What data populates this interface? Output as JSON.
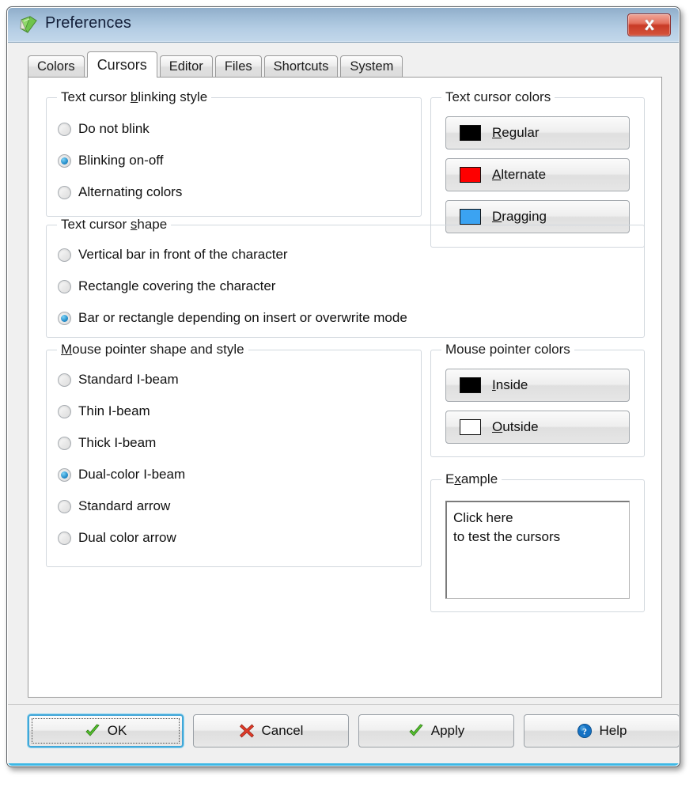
{
  "window": {
    "title": "Preferences",
    "icon": "notebook-icon",
    "close_label": "x"
  },
  "tabs": [
    {
      "label": "Colors",
      "active": false
    },
    {
      "label": "Cursors",
      "active": true
    },
    {
      "label": "Editor",
      "active": false
    },
    {
      "label": "Files",
      "active": false
    },
    {
      "label": "Shortcuts",
      "active": false
    },
    {
      "label": "System",
      "active": false
    }
  ],
  "groups": {
    "blinking_style": {
      "title_pre": "Text cursor ",
      "title_accel": "b",
      "title_post": "linking style",
      "options": [
        {
          "label": "Do not blink",
          "selected": false
        },
        {
          "label": "Blinking on-off",
          "selected": true
        },
        {
          "label": "Alternating colors",
          "selected": false
        }
      ]
    },
    "cursor_shape": {
      "title_pre": "Text cursor ",
      "title_accel": "s",
      "title_post": "hape",
      "options": [
        {
          "label": "Vertical bar in front of the character",
          "selected": false
        },
        {
          "label": "Rectangle covering the character",
          "selected": false
        },
        {
          "label": "Bar or rectangle depending on insert or overwrite mode",
          "selected": true
        }
      ]
    },
    "pointer_shape": {
      "title_pre": "",
      "title_accel": "M",
      "title_post": "ouse pointer shape and style",
      "options": [
        {
          "label": "Standard I-beam",
          "selected": false
        },
        {
          "label": "Thin I-beam",
          "selected": false
        },
        {
          "label": "Thick I-beam",
          "selected": false
        },
        {
          "label": "Dual-color I-beam",
          "selected": true
        },
        {
          "label": "Standard arrow",
          "selected": false
        },
        {
          "label": "Dual color arrow",
          "selected": false
        }
      ]
    },
    "cursor_colors": {
      "title": "Text cursor colors",
      "buttons": [
        {
          "accel": "R",
          "rest": "egular",
          "color": "#000000"
        },
        {
          "accel": "A",
          "rest": "lternate",
          "color": "#fe0000"
        },
        {
          "accel": "D",
          "rest": "ragging",
          "color": "#3ba3f2"
        }
      ]
    },
    "pointer_colors": {
      "title": "Mouse pointer colors",
      "buttons": [
        {
          "accel": "I",
          "rest": "nside",
          "color": "#000000"
        },
        {
          "accel": "O",
          "rest": "utside",
          "color": "#ffffff"
        }
      ]
    },
    "example": {
      "title_pre": "E",
      "title_accel": "x",
      "title_post": "ample",
      "lines": [
        "Click here",
        "to test the cursors"
      ]
    }
  },
  "footer": {
    "buttons": [
      {
        "label": "OK",
        "icon": "check-icon",
        "focused": true
      },
      {
        "label": "Cancel",
        "icon": "cross-icon",
        "focused": false
      },
      {
        "label": "Apply",
        "icon": "check-icon",
        "focused": false
      },
      {
        "label": "Help",
        "icon": "question-icon",
        "focused": false
      }
    ]
  }
}
